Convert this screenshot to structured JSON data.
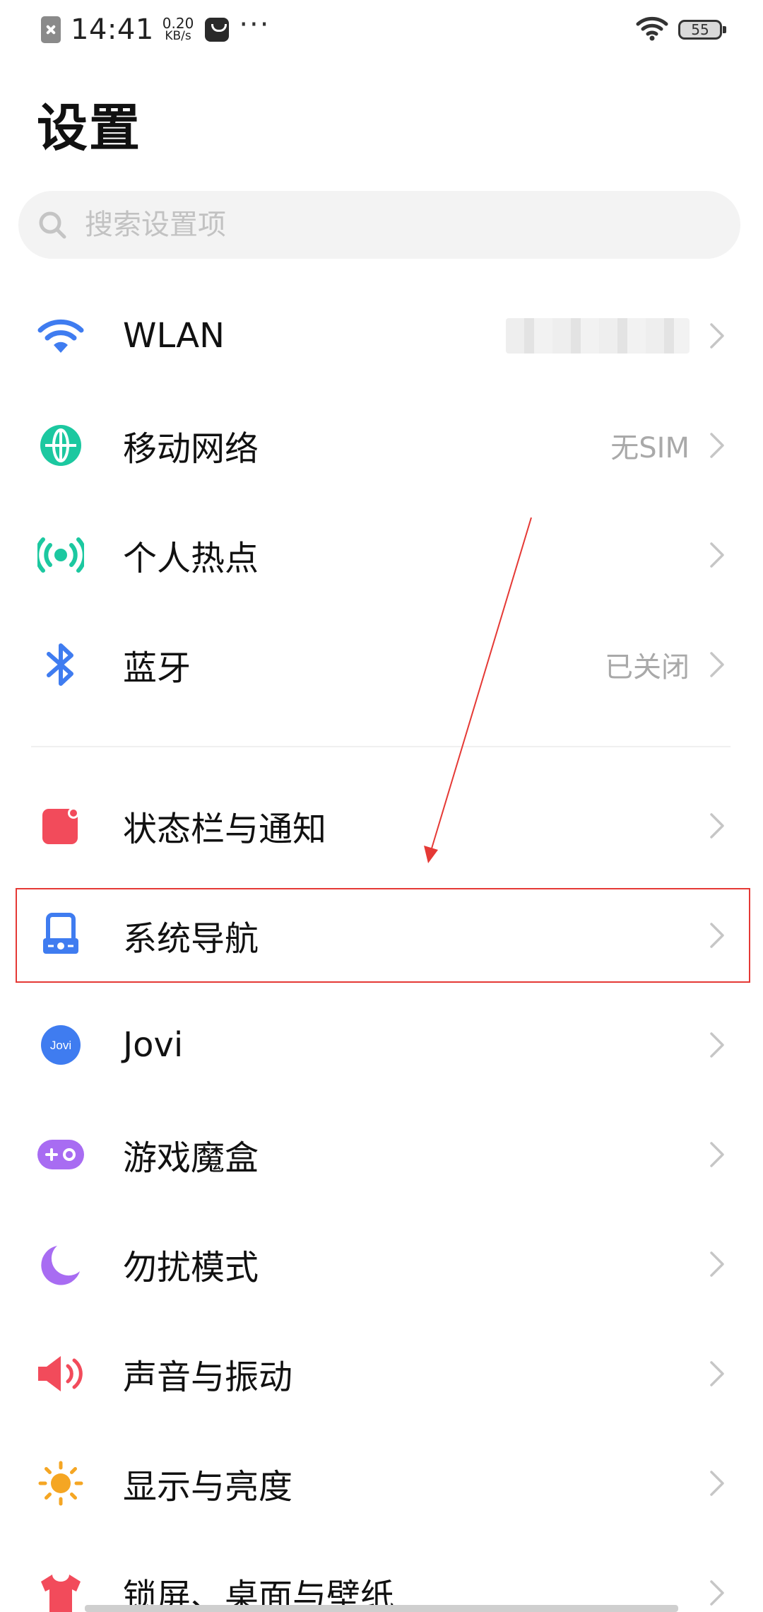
{
  "status_bar": {
    "time": "14:41",
    "speed_value": "0.20",
    "speed_unit": "KB/s",
    "more": "···",
    "battery": "55"
  },
  "page_title": "设置",
  "search": {
    "placeholder": "搜索设置项"
  },
  "items": [
    {
      "label": "WLAN",
      "value": "",
      "icon": "wifi-icon"
    },
    {
      "label": "移动网络",
      "value": "无SIM",
      "icon": "globe-icon"
    },
    {
      "label": "个人热点",
      "value": "",
      "icon": "hotspot-icon"
    },
    {
      "label": "蓝牙",
      "value": "已关闭",
      "icon": "bluetooth-icon"
    },
    {
      "label": "状态栏与通知",
      "value": "",
      "icon": "notification-icon"
    },
    {
      "label": "系统导航",
      "value": "",
      "icon": "navigation-icon"
    },
    {
      "label": "Jovi",
      "value": "",
      "icon": "jovi-icon",
      "badge": "Jovi"
    },
    {
      "label": "游戏魔盒",
      "value": "",
      "icon": "game-box-icon"
    },
    {
      "label": "勿扰模式",
      "value": "",
      "icon": "moon-icon"
    },
    {
      "label": "声音与振动",
      "value": "",
      "icon": "speaker-icon"
    },
    {
      "label": "显示与亮度",
      "value": "",
      "icon": "sun-icon"
    },
    {
      "label": "锁屏、桌面与壁纸",
      "value": "",
      "icon": "shirt-icon"
    }
  ],
  "colors": {
    "blue": "#3f7cf0",
    "teal": "#1cc8a0",
    "red": "#f24b5b",
    "purple": "#a86cf2",
    "orange": "#f5a623",
    "annotation": "#e53935"
  }
}
